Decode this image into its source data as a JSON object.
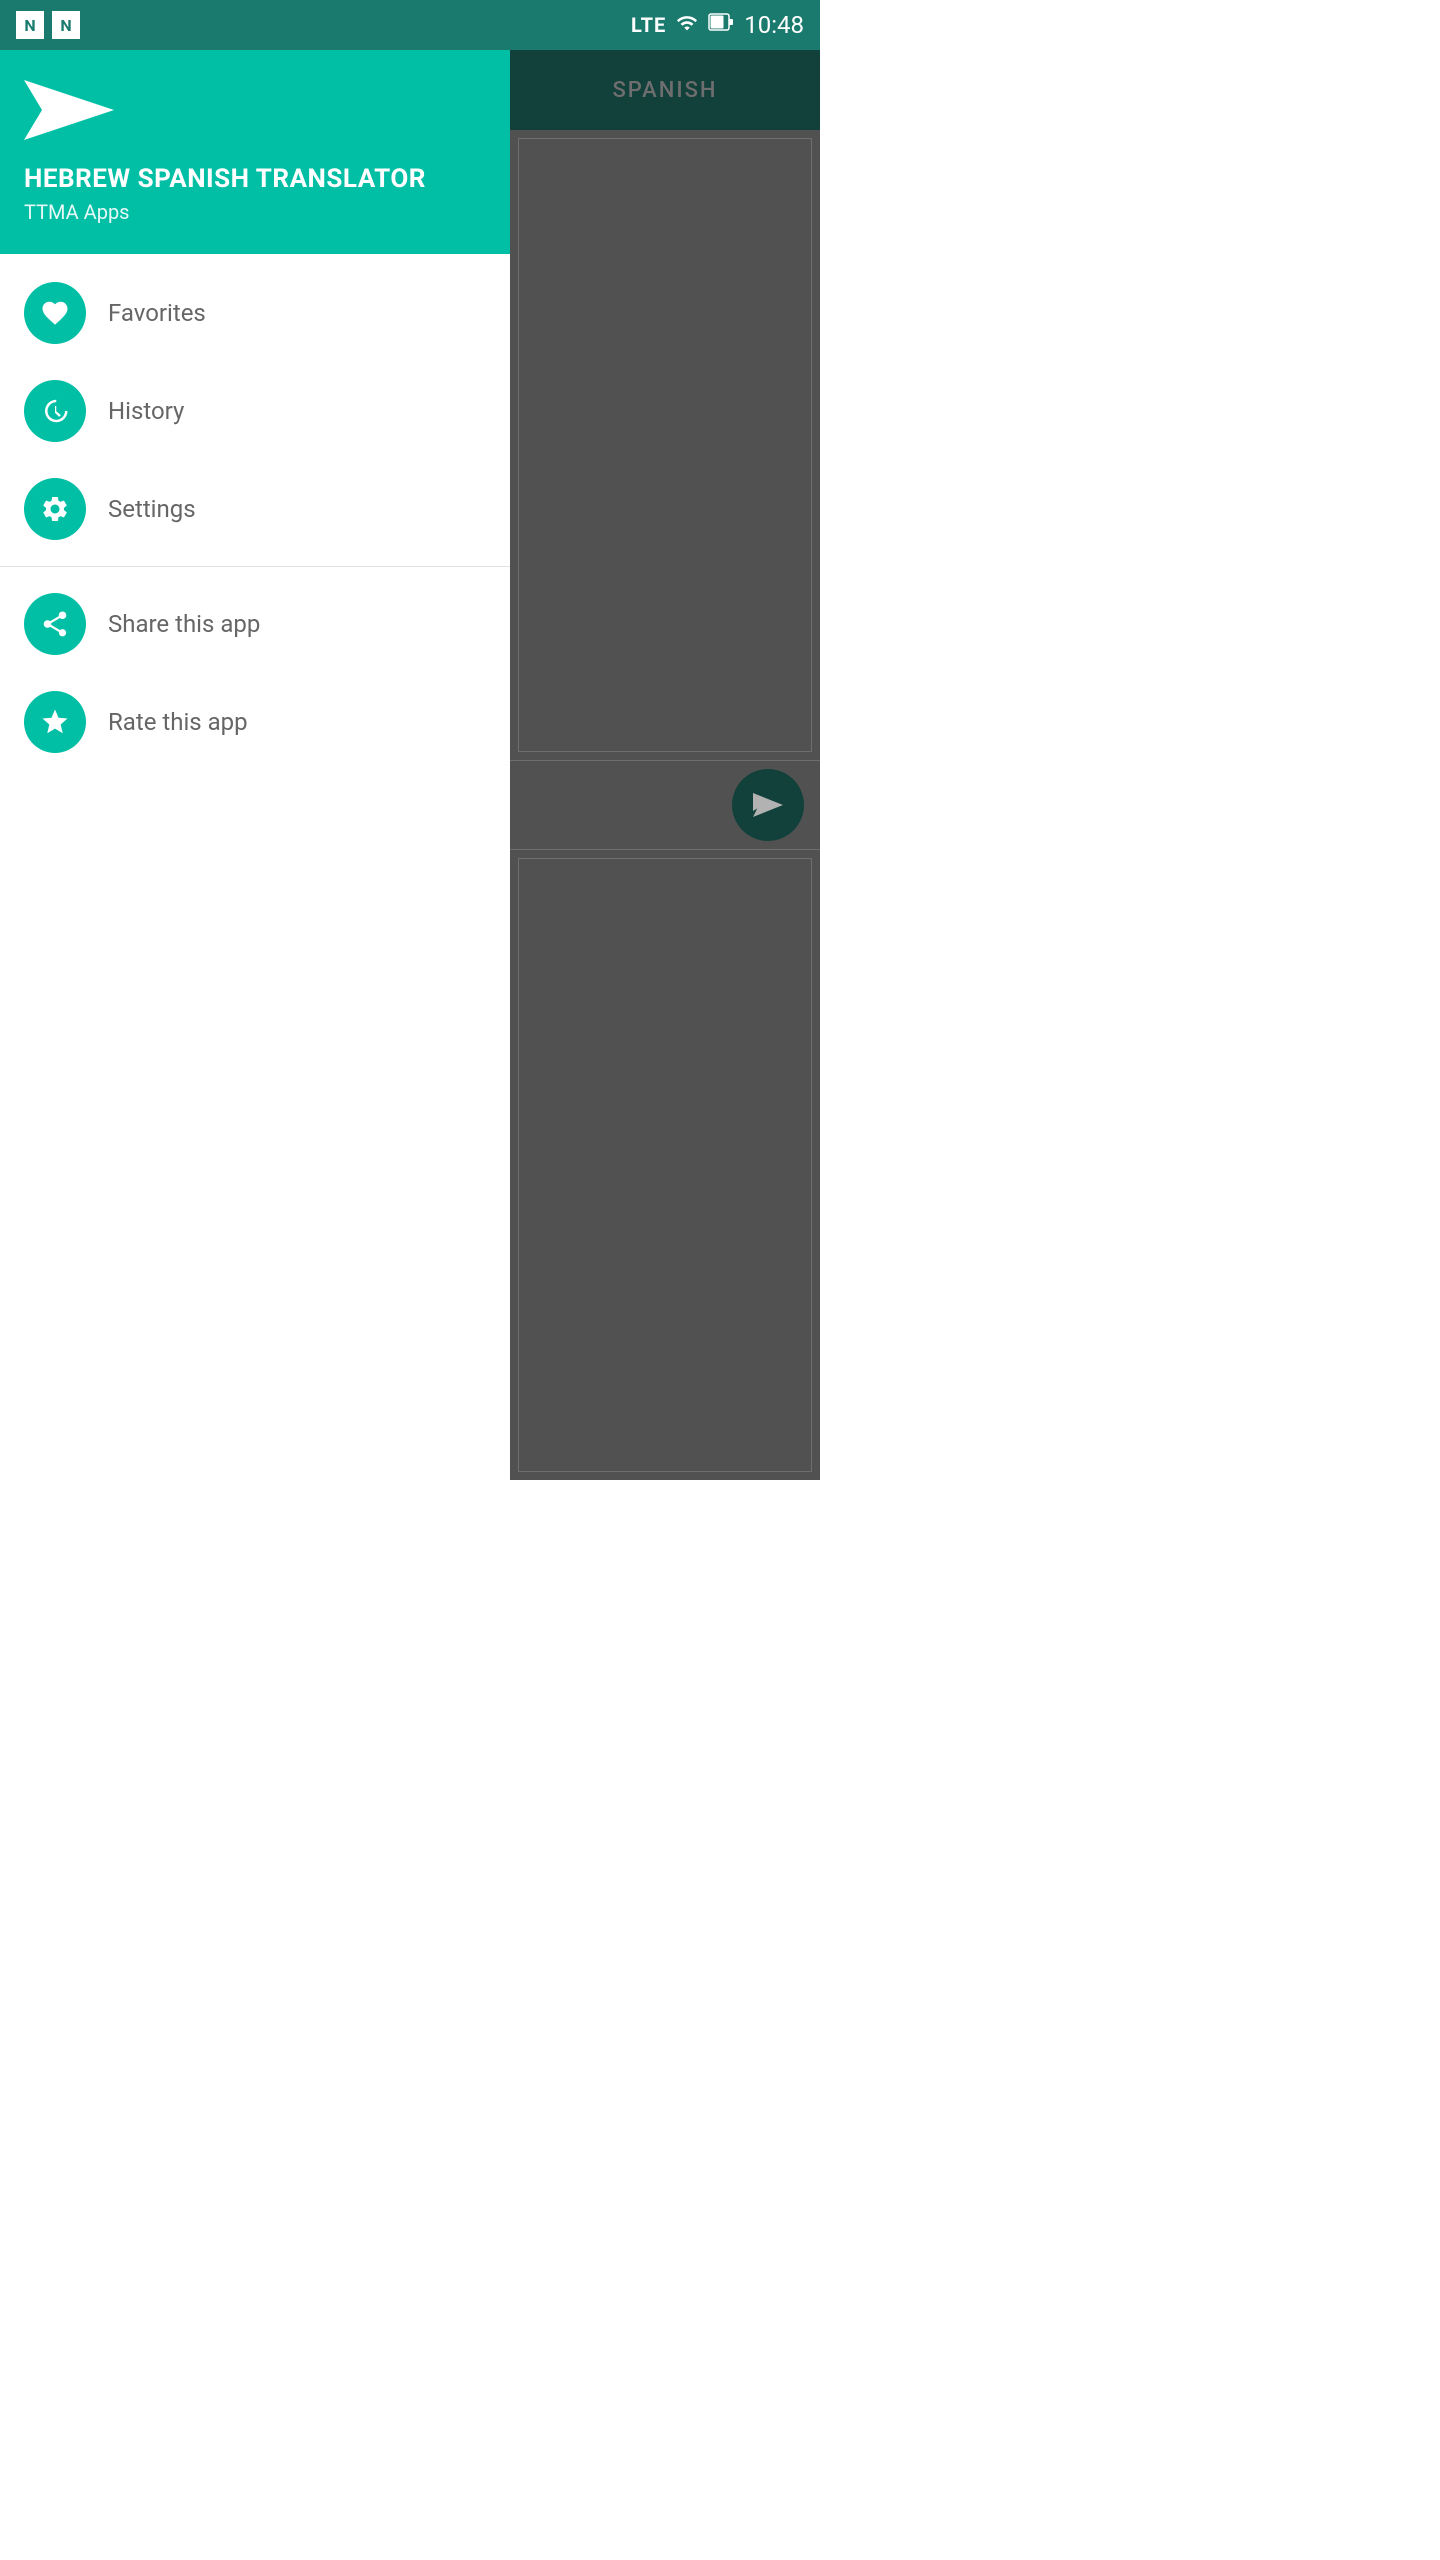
{
  "statusBar": {
    "lte": "LTE",
    "time": "10:48"
  },
  "drawer": {
    "appTitle": "HEBREW SPANISH TRANSLATOR",
    "appSubtitle": "TTMA Apps",
    "navItems": [
      {
        "id": "favorites",
        "label": "Favorites",
        "icon": "heart"
      },
      {
        "id": "history",
        "label": "History",
        "icon": "clock"
      },
      {
        "id": "settings",
        "label": "Settings",
        "icon": "gear"
      }
    ],
    "bottomItems": [
      {
        "id": "share",
        "label": "Share this app",
        "icon": "share"
      },
      {
        "id": "rate",
        "label": "Rate this app",
        "icon": "star"
      }
    ]
  },
  "rightPanel": {
    "languageLabel": "SPANISH"
  },
  "colors": {
    "teal": "#00BFA5",
    "darkTeal": "#1a5c54",
    "statusBarTeal": "#1a7a6e"
  }
}
